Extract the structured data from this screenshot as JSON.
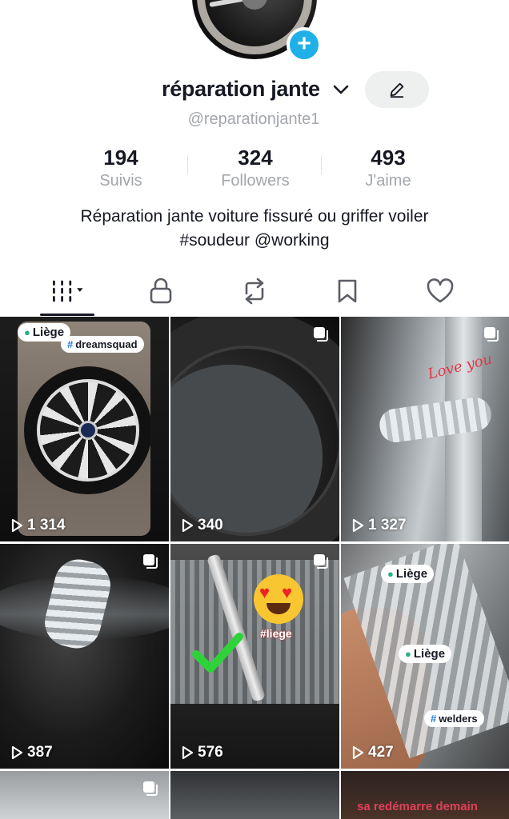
{
  "profile": {
    "display_name": "réparation jante",
    "handle": "@reparationjante1",
    "bio_line1": "Réparation jante voiture fissuré ou griffer voiler",
    "bio_line2": "#soudeur @working"
  },
  "stats": [
    {
      "value": "194",
      "label": "Suivis"
    },
    {
      "value": "324",
      "label": "Followers"
    },
    {
      "value": "493",
      "label": "J'aime"
    }
  ],
  "tabs": [
    {
      "icon": "grid-icon",
      "active": true
    },
    {
      "icon": "lock-icon"
    },
    {
      "icon": "repost-icon"
    },
    {
      "icon": "bookmark-icon"
    },
    {
      "icon": "heart-icon"
    }
  ],
  "videos": [
    {
      "views": "1 314",
      "chips": [
        "Liège",
        "dreamsquad"
      ]
    },
    {
      "views": "340"
    },
    {
      "views": "1 327",
      "overlay_text": "Love you"
    },
    {
      "views": "387"
    },
    {
      "views": "576",
      "overlay_text": "#liege"
    },
    {
      "views": "427",
      "chips": [
        "Liège",
        "Liège",
        "welders"
      ]
    },
    {
      "views": ""
    },
    {
      "views": ""
    },
    {
      "views": "",
      "overlay_text": "sa redémarre demain"
    }
  ],
  "colors": {
    "accent": "#20b0e8",
    "text": "#161823",
    "muted": "#a3a6ab"
  }
}
